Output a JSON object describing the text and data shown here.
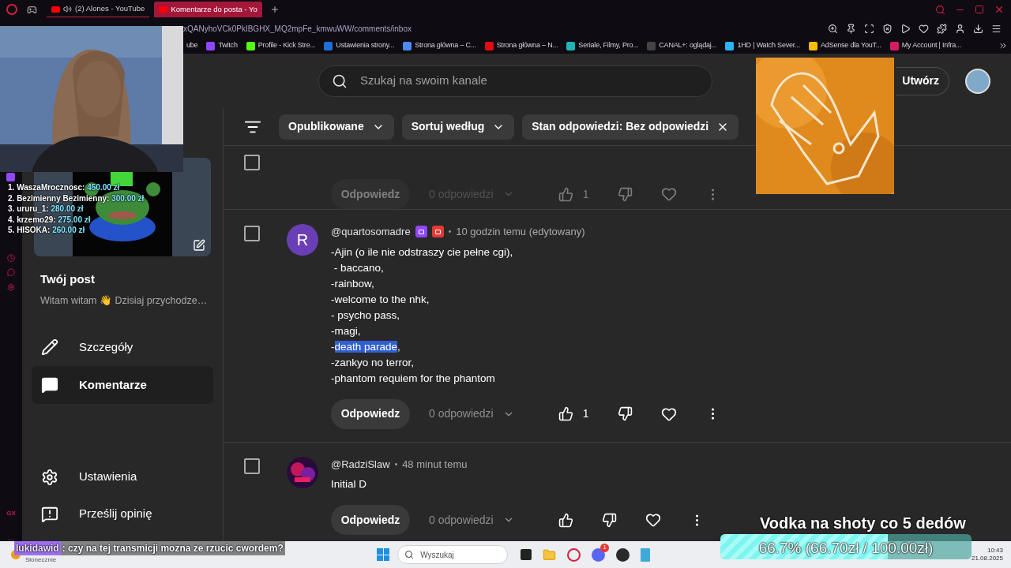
{
  "browser": {
    "tabs": [
      {
        "title": "(2) Alones - YouTube",
        "selected": false,
        "audio": true
      },
      {
        "title": "Komentarze do posta - Yo",
        "selected": true,
        "audio": false
      }
    ],
    "url": "xQANyhoVCk0PkIBGHX_MQ2mpFe_kmwuWW/comments/inbox",
    "bookmarks": [
      {
        "label": "ube"
      },
      {
        "label": "Twitch",
        "color": "#9146ff"
      },
      {
        "label": "Profile - Kick Stre...",
        "color": "#53fc18"
      },
      {
        "label": "Ustawienia strony...",
        "color": "#1e6fd9"
      },
      {
        "label": "Strona główna – C...",
        "color": "#4a8cf0"
      },
      {
        "label": "Strona główna – N...",
        "color": "#e50914"
      },
      {
        "label": "Seriale, Filmy, Pro...",
        "color": "#1fb5b5"
      },
      {
        "label": "CANAL+: oglądaj...",
        "color": "#444444"
      },
      {
        "label": "1HD | Watch Sever...",
        "color": "#29b6f6"
      },
      {
        "label": "AdSense dla YouT...",
        "color": "#fbbc04"
      },
      {
        "label": "My Account | Infra...",
        "color": "#d81b60"
      }
    ],
    "gx_label": "GX",
    "more_label": "..."
  },
  "studio": {
    "search": {
      "placeholder": "Szukaj na swoim kanale"
    },
    "create_label": "Utwórz",
    "post": {
      "title": "Twój post",
      "subtitle": "Witam witam 👋 Dzisiaj przychodze…"
    },
    "nav": [
      {
        "label": "Szczegóły",
        "selected": false
      },
      {
        "label": "Komentarze",
        "selected": true
      }
    ],
    "nav_bottom": [
      {
        "label": "Ustawienia"
      },
      {
        "label": "Prześlij opinię"
      }
    ],
    "filters": [
      {
        "label": "Opublikowane",
        "kind": "dropdown"
      },
      {
        "label": "Sortuj według",
        "kind": "dropdown"
      },
      {
        "label": "Stan odpowiedzi: Bez odpowiedzi",
        "kind": "removable"
      }
    ],
    "select_all": {
      "checked": false
    },
    "comments": [
      {
        "kind": "partial",
        "reply_label": "Odpowiedz",
        "replies": "0 odpowiedzi",
        "likes": "1"
      },
      {
        "kind": "full",
        "checked": false,
        "avatar": {
          "kind": "letter",
          "initial": "R"
        },
        "author": "@quartosomadre",
        "badges": [
          {
            "color": "#9146ff"
          },
          {
            "color": "#e53935"
          }
        ],
        "dot": "•",
        "time": "10 godzin temu (edytowany)",
        "lines": [
          [
            {
              "text": "-Ajin (o ile nie odstraszy cie pełne cgi),",
              "selected": false
            }
          ],
          [
            {
              "text": " - baccano,",
              "selected": false
            }
          ],
          [
            {
              "text": "-rainbow,",
              "selected": false
            }
          ],
          [
            {
              "text": "-welcome to the nhk,",
              "selected": false
            }
          ],
          [
            {
              "text": "- psycho pass,",
              "selected": false
            }
          ],
          [
            {
              "text": "-magi,",
              "selected": false
            }
          ],
          [
            {
              "text": "-",
              "selected": false
            },
            {
              "text": "death parade",
              "selected": true
            },
            {
              "text": ",",
              "selected": false
            }
          ],
          [
            {
              "text": "-zankyo no terror,",
              "selected": false
            }
          ],
          [
            {
              "text": "-phantom requiem for the phantom",
              "selected": false
            }
          ]
        ],
        "reply_label": "Odpowiedz",
        "replies": "0 odpowiedzi",
        "likes": "1"
      },
      {
        "kind": "full",
        "checked": false,
        "avatar": {
          "kind": "picture"
        },
        "author": "@RadziSlaw",
        "dot": "•",
        "time": "48 minut temu",
        "lines": [
          [
            {
              "text": "Initial D",
              "selected": false
            }
          ]
        ],
        "reply_label": "Odpowiedz",
        "replies": "0 odpowiedzi"
      }
    ]
  },
  "overlay": {
    "donors": [
      {
        "rank": "1.",
        "name": "WaszaMrocznosc:",
        "amount": "450.00 zł"
      },
      {
        "rank": "2.",
        "name": "Bezimienny Bezimienny:",
        "amount": "300.00 zł"
      },
      {
        "rank": "3.",
        "name": "ururu_1:",
        "amount": "280.00 zł"
      },
      {
        "rank": "4.",
        "name": "krzemo29:",
        "amount": "275.00 zł"
      },
      {
        "rank": "5.",
        "name": "HISOKA:",
        "amount": "260.00 zł"
      }
    ],
    "goal": {
      "title": "Vodka na shoty co 5 dedów",
      "label": "66.7% (66.70zł / 100.00zł)",
      "level": 0.667
    },
    "chat": {
      "user": "lukidawid",
      "message": ": czy na tej transmicji mozna ze rzucic cwordem?"
    }
  },
  "taskbar": {
    "weather": "Słonecznie",
    "search_placeholder": "Wyszukaj",
    "badge": "1",
    "time": "10:43",
    "date": "21.08.2025"
  }
}
